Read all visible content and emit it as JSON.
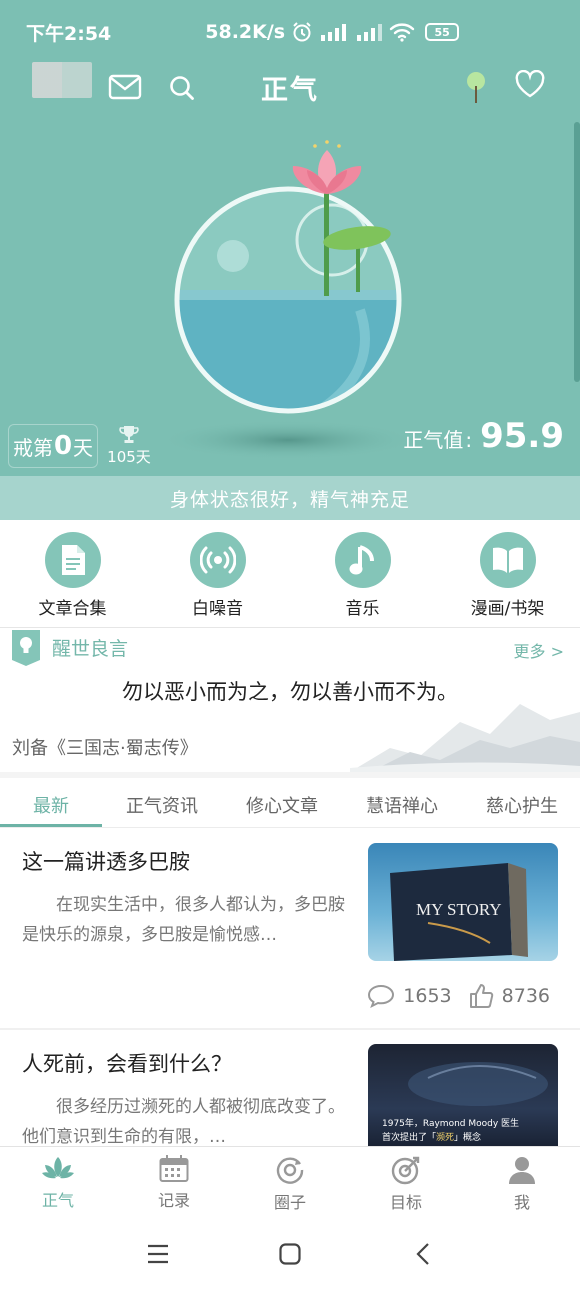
{
  "status_bar": {
    "time": "下午2:54",
    "speed": "58.2K/s",
    "battery": "55"
  },
  "header": {
    "title": "正气"
  },
  "hero": {
    "streak_prefix": "戒第",
    "streak_days": "0",
    "streak_suffix": "天",
    "record_label": "105天",
    "score_label": "正气值",
    "score_value": "95.9",
    "status_message": "身体状态很好，精气神充足"
  },
  "quick_links": [
    {
      "label": "文章合集",
      "icon": "document-icon"
    },
    {
      "label": "白噪音",
      "icon": "broadcast-icon"
    },
    {
      "label": "音乐",
      "icon": "music-note-icon"
    },
    {
      "label": "漫画/书架",
      "icon": "book-icon"
    }
  ],
  "quote": {
    "title": "醒世良言",
    "more": "更多 >",
    "text": "勿以恶小而为之，勿以善小而不为。",
    "author": "刘备《三国志·蜀志传》"
  },
  "tabs": [
    {
      "label": "最新",
      "active": true
    },
    {
      "label": "正气资讯"
    },
    {
      "label": "修心文章"
    },
    {
      "label": "慧语禅心"
    },
    {
      "label": "慈心护生"
    }
  ],
  "articles": [
    {
      "title": "这一篇讲透多巴胺",
      "excerpt": "在现实生活中，很多人都认为，多巴胺是快乐的源泉，多巴胺是愉悦感…",
      "thumb_text": "MY STORY",
      "comments": "1653",
      "likes": "8736"
    },
    {
      "title": "人死前，会看到什么？",
      "excerpt": "很多经历过濒死的人都被彻底改变了。    他们意识到生命的有限，…",
      "thumb_line1": "1975年，Raymond Moody 医生",
      "thumb_line2_pre": "首次提出了「",
      "thumb_line2_em": "濒死",
      "thumb_line2_post": "」概念"
    }
  ],
  "bottom_nav": [
    {
      "label": "正气",
      "active": true
    },
    {
      "label": "记录"
    },
    {
      "label": "圈子"
    },
    {
      "label": "目标"
    },
    {
      "label": "我"
    }
  ],
  "colors": {
    "teal": "#7cbfb3",
    "accent": "#6db3a6",
    "strip": "#a6d4cd"
  }
}
